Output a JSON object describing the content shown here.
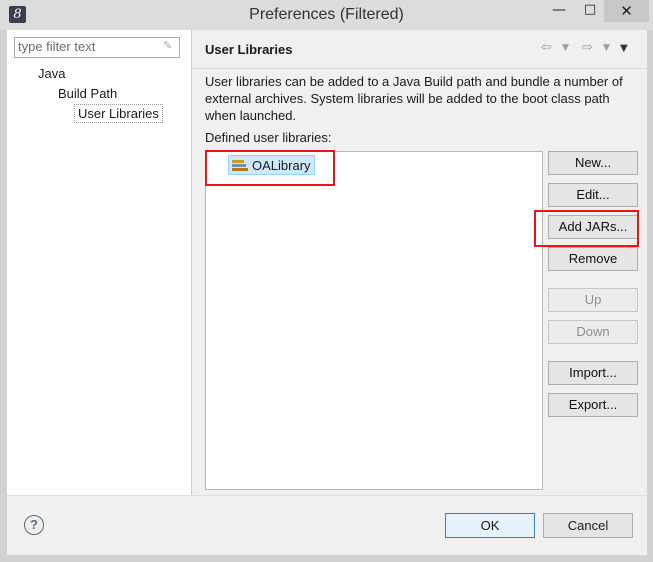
{
  "window": {
    "title": "Preferences (Filtered)",
    "minimize_glyph": "—",
    "maximize_glyph": "□",
    "close_glyph": "✕",
    "app_icon_glyph": "8"
  },
  "filter": {
    "placeholder": "type filter text",
    "value": ""
  },
  "tree": {
    "java": "Java",
    "build_path": "Build Path",
    "user_libraries": "User Libraries"
  },
  "page": {
    "title": "User Libraries",
    "nav": {
      "back_glyph": "⇦",
      "forward_glyph": "⇨",
      "menu_glyph": "▼",
      "view_menu_glyph": "▼"
    },
    "description": "User libraries can be added to a Java Build path and bundle a number of external archives. System libraries will be added to the boot class path when launched.",
    "defined_label": "Defined user libraries:",
    "libraries": [
      {
        "name": "OALibrary"
      }
    ]
  },
  "buttons": {
    "new": "New...",
    "edit": "Edit...",
    "add_jars": "Add JARs...",
    "remove": "Remove",
    "up": "Up",
    "down": "Down",
    "import": "Import...",
    "export": "Export..."
  },
  "dialog": {
    "help_glyph": "?",
    "ok": "OK",
    "cancel": "Cancel"
  },
  "colors": {
    "highlight_box": "#e8141c",
    "selection": "#cde8ff"
  }
}
